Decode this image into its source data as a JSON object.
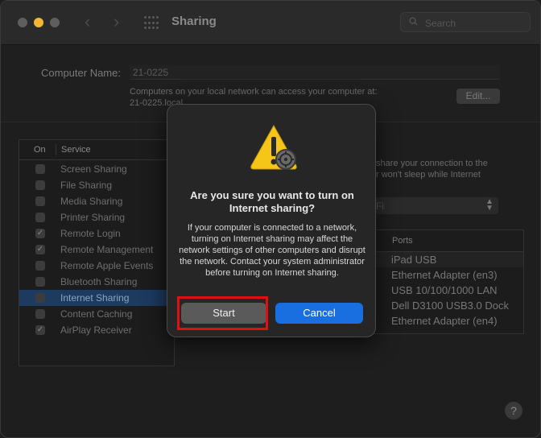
{
  "window": {
    "title": "Sharing",
    "search_placeholder": "Search"
  },
  "computer_name": {
    "label": "Computer Name:",
    "value": "21-0225",
    "description": "Computers on your local network can access your computer at:",
    "local_address": "21-0225.local",
    "edit_label": "Edit..."
  },
  "services": {
    "header_on": "On",
    "header_service": "Service",
    "items": [
      {
        "label": "Screen Sharing",
        "checked": false
      },
      {
        "label": "File Sharing",
        "checked": false
      },
      {
        "label": "Media Sharing",
        "checked": false
      },
      {
        "label": "Printer Sharing",
        "checked": false
      },
      {
        "label": "Remote Login",
        "checked": true
      },
      {
        "label": "Remote Management",
        "checked": true
      },
      {
        "label": "Remote Apple Events",
        "checked": false
      },
      {
        "label": "Bluetooth Sharing",
        "checked": false
      },
      {
        "label": "Internet Sharing",
        "checked": false,
        "selected": true
      },
      {
        "label": "Content Caching",
        "checked": false
      },
      {
        "label": "AirPlay Receiver",
        "checked": true
      }
    ]
  },
  "right_panel": {
    "text_line1": "share your connection to the",
    "text_line2": "r won't sleep while Internet",
    "dropdown_value": "Fi",
    "ports_header": "Ports",
    "ports": [
      "iPad USB",
      "Ethernet Adapter (en3)",
      "USB 10/100/1000 LAN",
      "Dell D3100 USB3.0 Dock",
      "Ethernet Adapter (en4)"
    ]
  },
  "dialog": {
    "title": "Are you sure you want to turn on Internet sharing?",
    "message": "If your computer is connected to a network, turning on Internet sharing may affect the network settings of other computers and disrupt the network. Contact your system administrator before turning on Internet sharing.",
    "start_label": "Start",
    "cancel_label": "Cancel"
  },
  "help_label": "?",
  "colors": {
    "accent": "#1a6fe0",
    "highlight_box": "#e01010",
    "warning_yellow": "#f5c518"
  }
}
